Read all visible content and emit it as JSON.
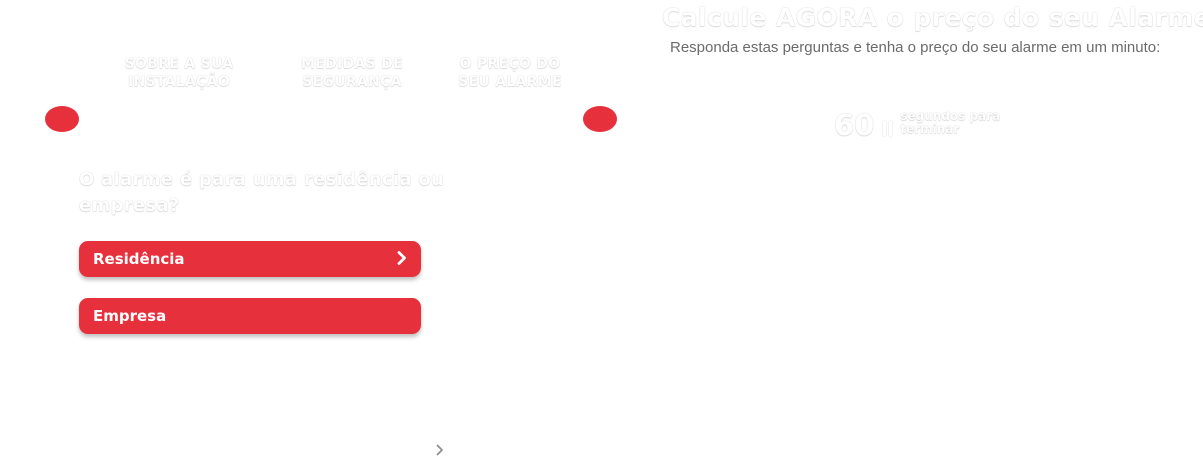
{
  "steps": [
    {
      "line1": "SOBRE A SUA",
      "line2": "INSTALAÇÃO"
    },
    {
      "line1": "MEDIDAS DE",
      "line2": "SEGURANÇA"
    },
    {
      "line1": "O PREÇO DO",
      "line2": "SEU ALARME"
    }
  ],
  "quiz": {
    "question_line1": "O alarme é para uma residência ou",
    "question_line2": "empresa?",
    "options": [
      {
        "label": "Residência",
        "icon": "chevron-right-icon"
      },
      {
        "label": "Empresa"
      }
    ],
    "next_icon": "chevron-right-icon"
  },
  "header": {
    "title": "Calcule AGORA o preço do seu Alarme",
    "subtitle": "Responda estas perguntas e tenha o preço do seu alarme em um minuto:"
  },
  "timer": {
    "seconds": "60",
    "label_line1": "segundos para",
    "label_line2": "terminar",
    "icon": "pause-icon"
  },
  "colors": {
    "accent": "#e6313d",
    "text_gray": "#6b6b6b",
    "background": "#ffffff"
  }
}
